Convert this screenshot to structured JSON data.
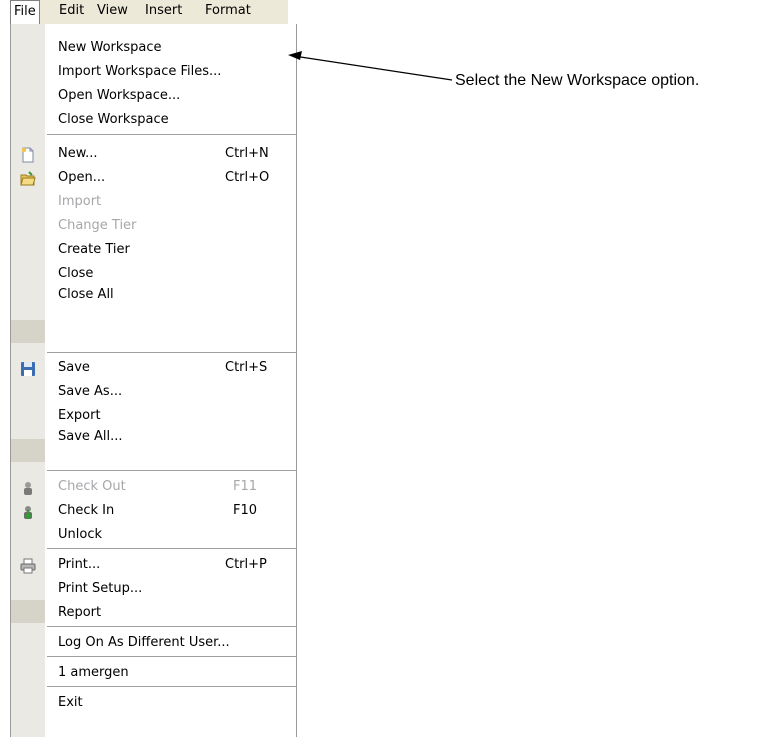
{
  "menubar": {
    "items": [
      "File",
      "Edit",
      "View",
      "Insert",
      "Format"
    ]
  },
  "menu": {
    "items": [
      {
        "label": "New Workspace",
        "shortcut": "",
        "disabled": false,
        "icon": ""
      },
      {
        "label": "Import Workspace Files...",
        "shortcut": "",
        "disabled": false,
        "icon": ""
      },
      {
        "label": "Open Workspace...",
        "shortcut": "",
        "disabled": false,
        "icon": ""
      },
      {
        "label": "Close Workspace",
        "shortcut": "",
        "disabled": false,
        "icon": ""
      },
      {
        "label": "New...",
        "shortcut": "Ctrl+N",
        "disabled": false,
        "icon": "new-document-icon"
      },
      {
        "label": "Open...",
        "shortcut": "Ctrl+O",
        "disabled": false,
        "icon": "open-folder-icon"
      },
      {
        "label": "Import",
        "shortcut": "",
        "disabled": true,
        "icon": ""
      },
      {
        "label": "Change Tier",
        "shortcut": "",
        "disabled": true,
        "icon": ""
      },
      {
        "label": "Create Tier",
        "shortcut": "",
        "disabled": false,
        "icon": ""
      },
      {
        "label": "Close",
        "shortcut": "",
        "disabled": false,
        "icon": ""
      },
      {
        "label": "Close All",
        "shortcut": "",
        "disabled": false,
        "icon": ""
      },
      {
        "label": "Save",
        "shortcut": "Ctrl+S",
        "disabled": false,
        "icon": "save-floppy-icon"
      },
      {
        "label": "Save As...",
        "shortcut": "",
        "disabled": false,
        "icon": ""
      },
      {
        "label": "Export",
        "shortcut": "",
        "disabled": false,
        "icon": ""
      },
      {
        "label": "Save All...",
        "shortcut": "",
        "disabled": false,
        "icon": ""
      },
      {
        "label": "Check Out",
        "shortcut": "F11",
        "disabled": true,
        "icon": "check-out-icon"
      },
      {
        "label": "Check In",
        "shortcut": "F10",
        "disabled": false,
        "icon": "check-in-icon"
      },
      {
        "label": "Unlock",
        "shortcut": "",
        "disabled": false,
        "icon": ""
      },
      {
        "label": "Print...",
        "shortcut": "Ctrl+P",
        "disabled": false,
        "icon": "printer-icon"
      },
      {
        "label": "Print Setup...",
        "shortcut": "",
        "disabled": false,
        "icon": ""
      },
      {
        "label": "Report",
        "shortcut": "",
        "disabled": false,
        "icon": ""
      },
      {
        "label": "Log On As Different User...",
        "shortcut": "",
        "disabled": false,
        "icon": ""
      },
      {
        "label": "1 amergen",
        "shortcut": "",
        "disabled": false,
        "icon": ""
      },
      {
        "label": "Exit",
        "shortcut": "",
        "disabled": false,
        "icon": ""
      }
    ]
  },
  "callout": {
    "text": "Select the New Workspace option."
  },
  "colors": {
    "menubar_bg": "#ece9d8",
    "gutter_bg": "#ebe9e3",
    "disabled_text": "#a7a6aa",
    "separator": "#a0a0a0"
  }
}
